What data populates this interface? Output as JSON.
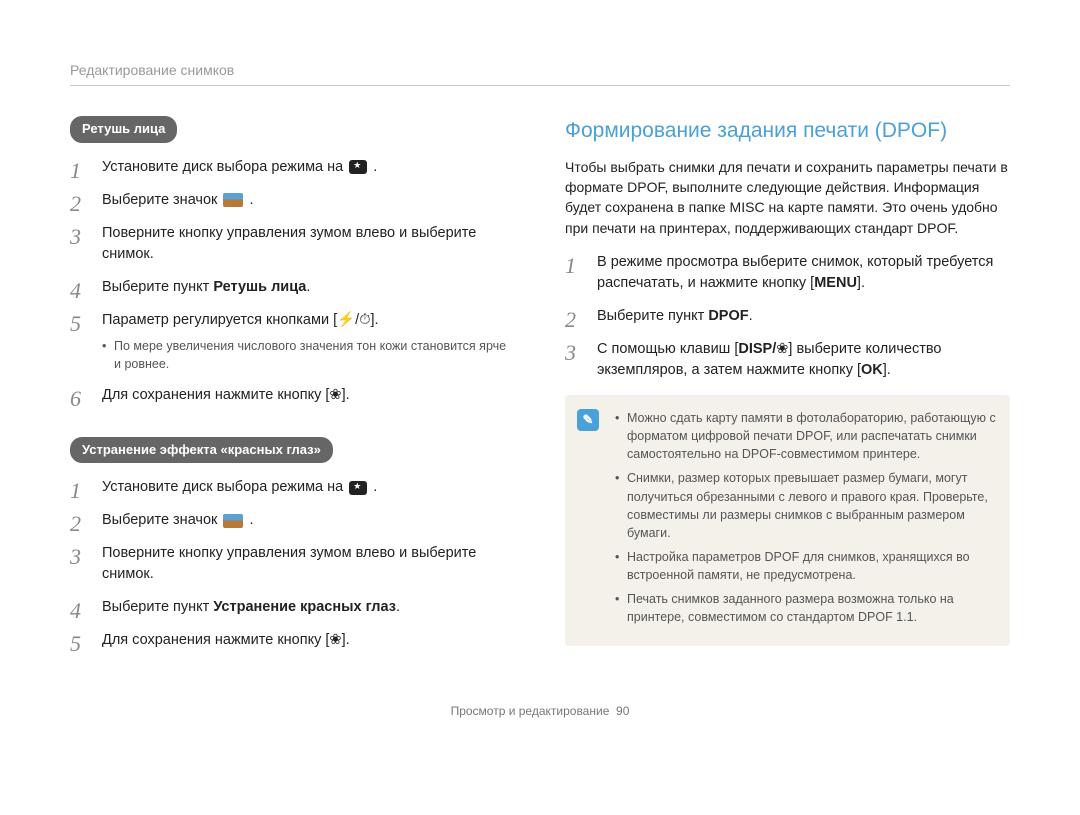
{
  "breadcrumb": "Редактирование снимков",
  "left": {
    "retouch": {
      "title": "Ретушь лица",
      "steps": [
        {
          "text_parts": [
            "Установите диск выбора режима на ",
            "{mode}",
            " ."
          ]
        },
        {
          "text_parts": [
            "Выберите значок ",
            "{thumb}",
            " ."
          ]
        },
        {
          "text_parts": [
            "Поверните кнопку управления зумом влево и выберите снимок."
          ]
        },
        {
          "text_parts": [
            "Выберите пункт "
          ],
          "bold_tail": "Ретушь лица",
          "tail": "."
        },
        {
          "text_parts": [
            "Параметр регулируется кнопками [",
            "{flash}",
            "/",
            "{timer}",
            "]."
          ],
          "sub": "По мере увеличения числового значения тон кожи становится ярче и ровнее."
        },
        {
          "text_parts": [
            "Для сохранения нажмите кнопку [",
            "{macro}",
            "]."
          ]
        }
      ]
    },
    "redeye": {
      "title": "Устранение эффекта «красных глаз»",
      "steps": [
        {
          "text_parts": [
            "Установите диск выбора режима на ",
            "{mode}",
            " ."
          ]
        },
        {
          "text_parts": [
            "Выберите значок ",
            "{thumb}",
            " ."
          ]
        },
        {
          "text_parts": [
            "Поверните кнопку управления зумом влево и выберите снимок."
          ]
        },
        {
          "text_parts": [
            "Выберите пункт "
          ],
          "bold_tail": "Устранение красных глаз",
          "tail": "."
        },
        {
          "text_parts": [
            "Для сохранения нажмите кнопку [",
            "{macro}",
            "]."
          ]
        }
      ]
    }
  },
  "right": {
    "heading": "Формирование задания печати (DPOF)",
    "intro": "Чтобы выбрать снимки для печати и сохранить параметры печати в формате DPOF, выполните следующие действия. Информация будет сохранена в папке MISC на карте памяти. Это очень удобно при печати на принтерах, поддерживающих стандарт DPOF.",
    "steps": [
      {
        "pre": "В режиме просмотра выберите снимок, который требуется распечатать, и нажмите кнопку [",
        "bold": "MENU",
        "post": "]."
      },
      {
        "pre": "Выберите пункт ",
        "bold": "DPOF",
        "post": "."
      },
      {
        "pre": "С помощью клавиш [",
        "bold": "DISP/",
        "glyph": "{macro}",
        "mid": "] выберите количество экземпляров, а затем нажмите кнопку [",
        "bold2": "OK",
        "post2": "]."
      }
    ],
    "notes": [
      "Можно сдать карту памяти в фотолабораторию, работающую с форматом цифровой печати DPOF, или распечатать снимки самостоятельно на DPOF-совместимом принтере.",
      "Снимки, размер которых превышает размер бумаги, могут получиться обрезанными с левого и правого края. Проверьте, совместимы ли размеры снимков с выбранным размером бумаги.",
      "Настройка параметров DPOF для снимков, хранящихся во встроенной памяти, не предусмотрена.",
      "Печать снимков заданного размера возможна только на принтере, совместимом со стандартом DPOF 1.1."
    ]
  },
  "footer": {
    "section": "Просмотр и редактирование",
    "page": "90"
  },
  "glyphs": {
    "flash": "⚡",
    "timer": "⏱",
    "macro": "❀"
  }
}
